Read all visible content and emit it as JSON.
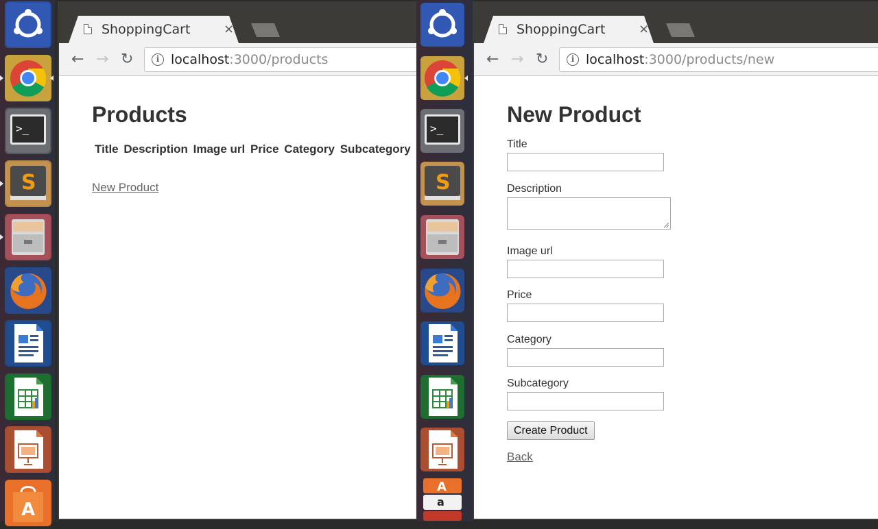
{
  "launcher": {
    "items": [
      "ubuntu-dash-icon",
      "chrome-icon",
      "terminal-icon",
      "sublime-text-icon",
      "files-cabinet-icon",
      "firefox-icon",
      "writer-icon",
      "calc-icon",
      "impress-icon",
      "software-center-icon"
    ],
    "colors": {
      "dash": "#2c4fa0",
      "chrome": "#c6a43e",
      "terminal": "#55585c",
      "sublime": "#b88948",
      "files": "#a24b54",
      "firefox": "#234a8c",
      "writer": "#1e4a8a",
      "calc": "#1c6b2f",
      "impress": "#a84b2f",
      "software": "#e8702a"
    }
  },
  "left_browser": {
    "tab_title": "ShoppingCart",
    "tab_close": "×",
    "url_host": "localhost",
    "url_path": ":3000/products",
    "heading": "Products",
    "table_headers": [
      "Title",
      "Description",
      "Image url",
      "Price",
      "Category",
      "Subcategory"
    ],
    "new_product_link": "New Product"
  },
  "right_browser": {
    "tab_title": "ShoppingCart",
    "tab_close": "×",
    "url_host": "localhost",
    "url_path": ":3000/products/new",
    "heading": "New Product",
    "fields": {
      "title": "Title",
      "description": "Description",
      "image_url": "Image url",
      "price": "Price",
      "category": "Category",
      "subcategory": "Subcategory"
    },
    "submit_label": "Create Product",
    "back_link": "Back"
  },
  "nav": {
    "back": "←",
    "forward": "→",
    "reload": "↻",
    "info": "i"
  }
}
